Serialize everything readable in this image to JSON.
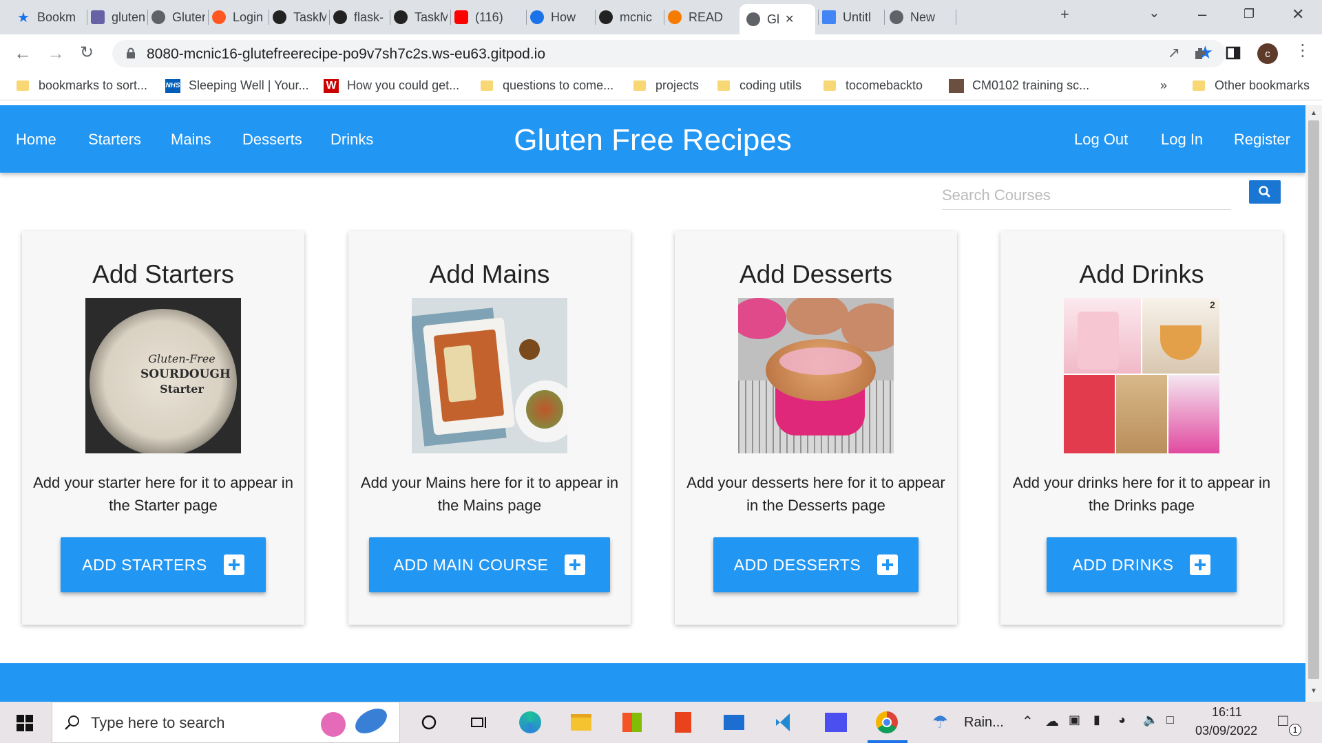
{
  "browser": {
    "tabs": [
      {
        "label": "Bookm",
        "icon": "star-icon"
      },
      {
        "label": "gluten",
        "icon": "heroku-icon"
      },
      {
        "label": "Gluten",
        "icon": "globe-icon"
      },
      {
        "label": "Login",
        "icon": "circle-icon"
      },
      {
        "label": "TaskM",
        "icon": "github-icon"
      },
      {
        "label": "flask-",
        "icon": "github-icon"
      },
      {
        "label": "TaskM",
        "icon": "github-icon"
      },
      {
        "label": "(116)",
        "icon": "youtube-icon"
      },
      {
        "label": "How",
        "icon": "help-icon"
      },
      {
        "label": "mcnic",
        "icon": "github-icon"
      },
      {
        "label": "READ",
        "icon": "codeanywhere-icon"
      },
      {
        "label": "Gl",
        "icon": "globe-icon"
      },
      {
        "label": "Untitl",
        "icon": "docs-icon"
      },
      {
        "label": "New",
        "icon": "chrome-icon"
      }
    ],
    "url": "8080-mcnic16-glutefreerecipe-po9v7sh7c2s.ws-eu63.gitpod.io",
    "profile_initial": "c",
    "bookmarks": [
      {
        "label": "bookmarks to sort...",
        "icon": "folder-icon"
      },
      {
        "label": "Sleeping Well | Your...",
        "icon": "nhs-icon"
      },
      {
        "label": "How you could get...",
        "icon": "w-icon"
      },
      {
        "label": "questions to come...",
        "icon": "folder-icon"
      },
      {
        "label": "projects",
        "icon": "folder-icon"
      },
      {
        "label": "coding utils",
        "icon": "folder-icon"
      },
      {
        "label": "tocomebackto",
        "icon": "folder-icon"
      },
      {
        "label": "CM0102 training sc...",
        "icon": "page-icon"
      }
    ],
    "more_bookmarks": "»",
    "other_bookmarks": "Other bookmarks"
  },
  "site": {
    "nav_left": [
      "Home",
      "Starters",
      "Mains",
      "Desserts",
      "Drinks"
    ],
    "brand": "Gluten Free Recipes",
    "nav_right": [
      "Log Out",
      "Log In",
      "Register"
    ],
    "search_placeholder": "Search Courses",
    "cards": [
      {
        "title": "Add Starters",
        "desc": "Add your starter here for it to appear in the Starter page",
        "button": "ADD STARTERS",
        "img_text": [
          "Gluten-Free",
          "SOURDOUGH",
          "Starter"
        ]
      },
      {
        "title": "Add Mains",
        "desc": "Add your Mains here for it to appear in the Mains page",
        "button": "ADD MAIN COURSE"
      },
      {
        "title": "Add Desserts",
        "desc": "Add your desserts here for it to appear in the Desserts page",
        "button": "ADD DESSERTS"
      },
      {
        "title": "Add Drinks",
        "desc": "Add your drinks here for it to appear in the Drinks page",
        "button": "ADD DRINKS",
        "img_badge": "2"
      }
    ],
    "accent": "#2196f3"
  },
  "taskbar": {
    "search_text": "Type here to search",
    "weather": "Rain...",
    "time": "16:11",
    "date": "03/09/2022",
    "notif_count": "1"
  }
}
